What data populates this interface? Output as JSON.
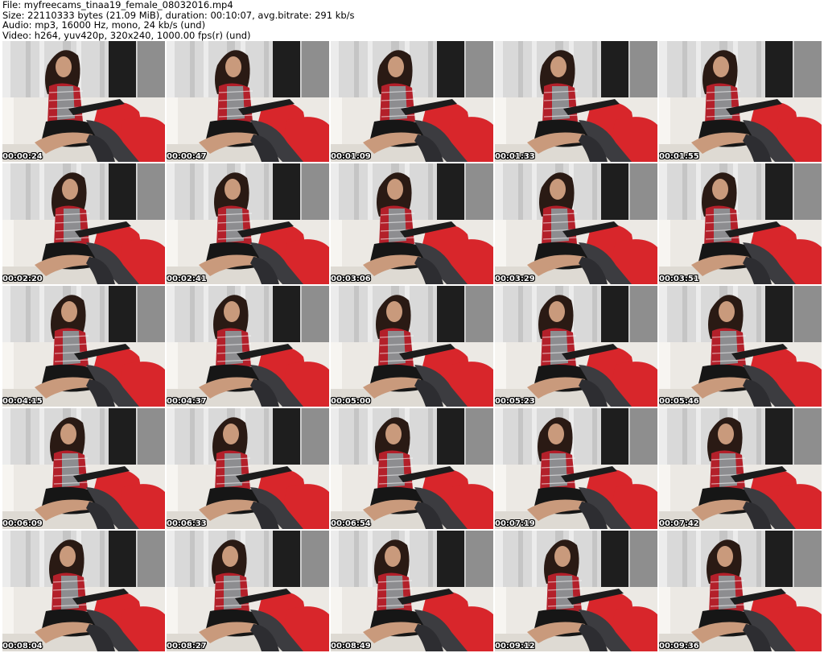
{
  "header": {
    "file_line": "File: myfreecams_tinaa19_female_08032016.mp4",
    "size_line": "Size: 22110333 bytes (21.09 MiB), duration: 00:10:07, avg.bitrate: 291 kb/s",
    "audio_line": "Audio: mp3, 16000 Hz, mono, 24 kb/s (und)",
    "video_line": "Video: h264, yuv420p, 320x240, 1000.00 fps(r) (und)"
  },
  "thumbnails": [
    {
      "timestamp": "00:00:24"
    },
    {
      "timestamp": "00:00:47"
    },
    {
      "timestamp": "00:01:09"
    },
    {
      "timestamp": "00:01:33"
    },
    {
      "timestamp": "00:01:55"
    },
    {
      "timestamp": "00:02:20"
    },
    {
      "timestamp": "00:02:41"
    },
    {
      "timestamp": "00:03:06"
    },
    {
      "timestamp": "00:03:29"
    },
    {
      "timestamp": "00:03:51"
    },
    {
      "timestamp": "00:04:15"
    },
    {
      "timestamp": "00:04:37"
    },
    {
      "timestamp": "00:05:00"
    },
    {
      "timestamp": "00:05:23"
    },
    {
      "timestamp": "00:05:46"
    },
    {
      "timestamp": "00:06:09"
    },
    {
      "timestamp": "00:06:33"
    },
    {
      "timestamp": "00:06:54"
    },
    {
      "timestamp": "00:07:19"
    },
    {
      "timestamp": "00:07:42"
    },
    {
      "timestamp": "00:08:04"
    },
    {
      "timestamp": "00:08:27"
    },
    {
      "timestamp": "00:08:49"
    },
    {
      "timestamp": "00:09:12"
    },
    {
      "timestamp": "00:09:36"
    }
  ],
  "colors": {
    "curtain_light": "#d9d9d9",
    "curtain_dark": "#8e8e8e",
    "couch": "#ece9e4",
    "pillow_red": "#d8262b",
    "shirt_red": "#b3202a",
    "hair": "#2a1a14",
    "skin": "#c99a7c",
    "socks": "#3c3c40",
    "skirt": "#161616"
  }
}
